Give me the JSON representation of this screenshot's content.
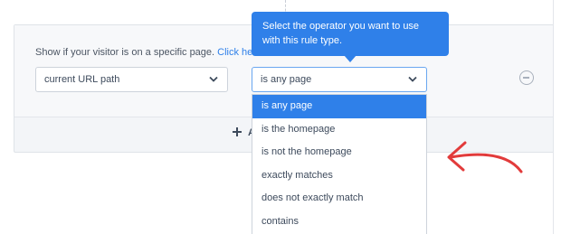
{
  "rule": {
    "prompt_text": "Show if your visitor is on a specific page.",
    "prompt_link": "Click he",
    "first_select_value": "current URL path",
    "operator_select_value": "is any page",
    "add_label": "A"
  },
  "tooltip": {
    "line1": "Select the operator you want to use",
    "line2": "with this rule type."
  },
  "dropdown": {
    "options": [
      "is any page",
      "is the homepage",
      "is not the homepage",
      "exactly matches",
      "does not exactly match",
      "contains"
    ],
    "selected_index": 0
  },
  "colors": {
    "accent": "#2f80e9",
    "annotation_arrow": "#e23b3b"
  }
}
